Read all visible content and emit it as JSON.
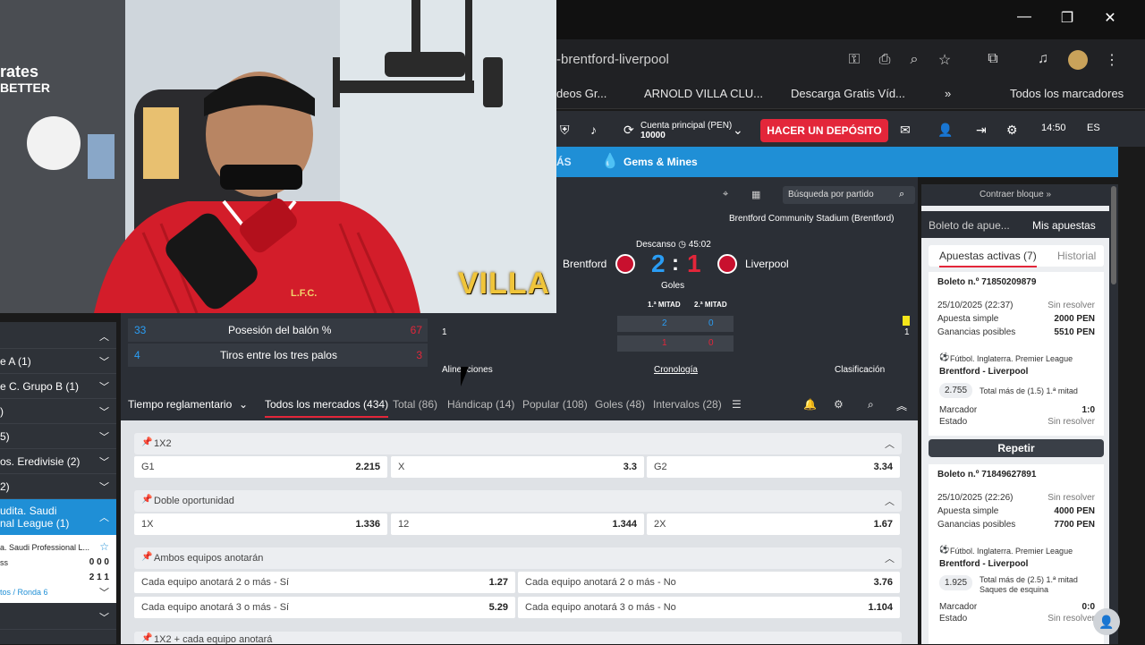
{
  "browser": {
    "address": "-brentford-liverpool",
    "bookmarks": [
      "deos Gr...",
      "ARNOLD VILLA CLU...",
      "Descarga Gratis Víd...",
      "Todos los marcadores"
    ],
    "more_label": "»"
  },
  "header": {
    "account_label": "Cuenta principal (PEN)",
    "account_balance": "10000",
    "deposit_label": "HACER UN DEPÓSITO",
    "time": "14:50",
    "lang": "ES"
  },
  "nav": {
    "more_label": "ÁS",
    "gems_label": "Gems & Mines"
  },
  "match": {
    "search_placeholder": "Búsqueda por partido",
    "stadium": "Brentford Community Stadium (Brentford)",
    "status": "Descanso",
    "clock": "45:02",
    "home": "Brentford",
    "away": "Liverpool",
    "home_score": "2",
    "away_score": "1",
    "score_sep": ":",
    "goals_label": "Goles",
    "half1_label": "1.ª MITAD",
    "half2_label": "2.ª MITAD",
    "home_half1": "2",
    "home_half2": "0",
    "away_half1": "1",
    "away_half2": "0",
    "home_cards": "1",
    "away_cards": "1",
    "stats": [
      {
        "label": "Posesión del balón %",
        "home": "33",
        "away": "67"
      },
      {
        "label": "Tiros entre los tres palos",
        "home": "4",
        "away": "3"
      }
    ],
    "lineups_label": "Alineaciones",
    "timeline_label": "Cronología",
    "standings_label": "Clasificación"
  },
  "sidebar": {
    "rows": [
      {
        "label": "e A (1)"
      },
      {
        "label": "e C. Grupo B (1)"
      },
      {
        "label": ")"
      },
      {
        "label": "5)"
      },
      {
        "label": "os. Eredivisie (2)"
      },
      {
        "label": "2)"
      }
    ],
    "active_label": "udita. Saudi\nnal League (1)",
    "match_league": "a. Saudi Professional L...",
    "match_team1": "ss",
    "match_score1": "0 0 0",
    "match_score2": "2 1 1",
    "match_round": "tos / Ronda 6"
  },
  "tabs": {
    "period": "Tiempo reglamentario",
    "items": [
      "Todos los mercados (434)",
      "Total (86)",
      "Hándicap (14)",
      "Popular (108)",
      "Goles (48)",
      "Intervalos (28)"
    ]
  },
  "markets": {
    "m1x2": {
      "title": "1X2",
      "odds": [
        {
          "l": "G1",
          "v": "2.215"
        },
        {
          "l": "X",
          "v": "3.3"
        },
        {
          "l": "G2",
          "v": "3.34"
        }
      ]
    },
    "double": {
      "title": "Doble oportunidad",
      "odds": [
        {
          "l": "1X",
          "v": "1.336"
        },
        {
          "l": "12",
          "v": "1.344"
        },
        {
          "l": "2X",
          "v": "1.67"
        }
      ]
    },
    "btts": {
      "title": "Ambos equipos anotarán",
      "odds": [
        {
          "l": "Cada equipo anotará 2 o más - Sí",
          "v": "1.27"
        },
        {
          "l": "Cada equipo anotará 2 o más - No",
          "v": "3.76"
        },
        {
          "l": "Cada equipo anotará 3 o más - Sí",
          "v": "5.29"
        },
        {
          "l": "Cada equipo anotará 3 o más - No",
          "v": "1.104"
        }
      ]
    },
    "next_title": "1X2 + cada equipo anotará"
  },
  "slip": {
    "collapse_label": "Contraer bloque »",
    "tab1": "Boleto de apue...",
    "tab2": "Mis apuestas",
    "active_tab": "Apuestas activas (7)",
    "history_tab": "Historial",
    "repeat_label": "Repetir",
    "tickets": [
      {
        "id": "Boleto n.º 71850209879",
        "date": "25/10/2025 (22:37)",
        "status": "Sin resolver",
        "type": "Apuesta simple",
        "stake": "2000 PEN",
        "win_label": "Ganancias posibles",
        "win": "5510 PEN",
        "league": "Fútbol. Inglaterra. Premier League",
        "match": "Brentford - Liverpool",
        "odd": "2.755",
        "pick": "Total más de (1.5) 1.ª mitad",
        "pick2": "",
        "score_label": "Marcador",
        "score": "1:0",
        "state_label": "Estado",
        "state": "Sin resolver"
      },
      {
        "id": "Boleto n.º 71849627891",
        "date": "25/10/2025 (22:26)",
        "status": "Sin resolver",
        "type": "Apuesta simple",
        "stake": "4000 PEN",
        "win_label": "Ganancias posibles",
        "win": "7700 PEN",
        "league": "Fútbol. Inglaterra. Premier League",
        "match": "Brentford - Liverpool",
        "odd": "1.925",
        "pick": "Total más de (2.5) 1.ª mitad",
        "pick2": "Saques de esquina",
        "score_label": "Marcador",
        "score": "0:0",
        "state_label": "Estado",
        "state": "Sin resolver"
      }
    ]
  },
  "webcam": {
    "overlay_text": "VILLA",
    "shirt_text": "L.F.C.",
    "sign_text": "rates",
    "sign_text2": "BETTER"
  },
  "colors": {
    "accent_red": "#e3263a",
    "accent_blue": "#1f8fd6",
    "dark_panel": "#2b2f36"
  }
}
